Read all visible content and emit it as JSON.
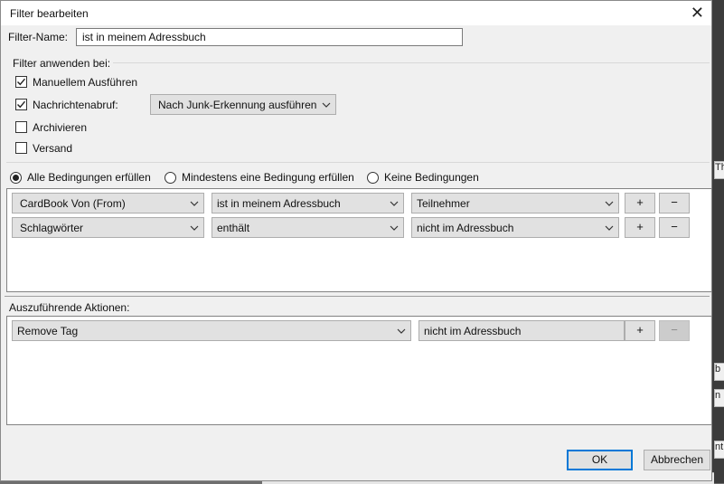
{
  "dialog": {
    "title": "Filter bearbeiten",
    "close_glyph": "✕"
  },
  "filter_name": {
    "label": "Filter-Name:",
    "value": "ist in meinem Adressbuch"
  },
  "apply_when": {
    "heading": "Filter anwenden bei:",
    "options": [
      {
        "label": "Manuellem Ausführen",
        "checked": true
      },
      {
        "label": "Nachrichtenabruf:",
        "checked": true
      },
      {
        "label": "Archivieren",
        "checked": false
      },
      {
        "label": "Versand",
        "checked": false
      }
    ],
    "fetch_mode_select": "Nach Junk-Erkennung ausführen"
  },
  "match": {
    "options": [
      {
        "label": "Alle Bedingungen erfüllen",
        "selected": true
      },
      {
        "label": "Mindestens eine Bedingung erfüllen",
        "selected": false
      },
      {
        "label": "Keine Bedingungen",
        "selected": false
      }
    ]
  },
  "conditions": [
    {
      "field": "CardBook Von (From)",
      "operator": "ist in meinem Adressbuch",
      "value": "Teilnehmer"
    },
    {
      "field": "Schlagwörter",
      "operator": "enthält",
      "value": "nicht im Adressbuch"
    }
  ],
  "actions": {
    "heading": "Auszuführende Aktionen:",
    "rows": [
      {
        "action": "Remove Tag",
        "value": "nicht im Adressbuch"
      }
    ]
  },
  "row_buttons": {
    "add": "+",
    "remove": "−"
  },
  "footer": {
    "ok": "OK",
    "cancel": "Abbrechen"
  },
  "background": {
    "side_items": [
      "Th",
      "b",
      "n",
      "nt"
    ]
  }
}
